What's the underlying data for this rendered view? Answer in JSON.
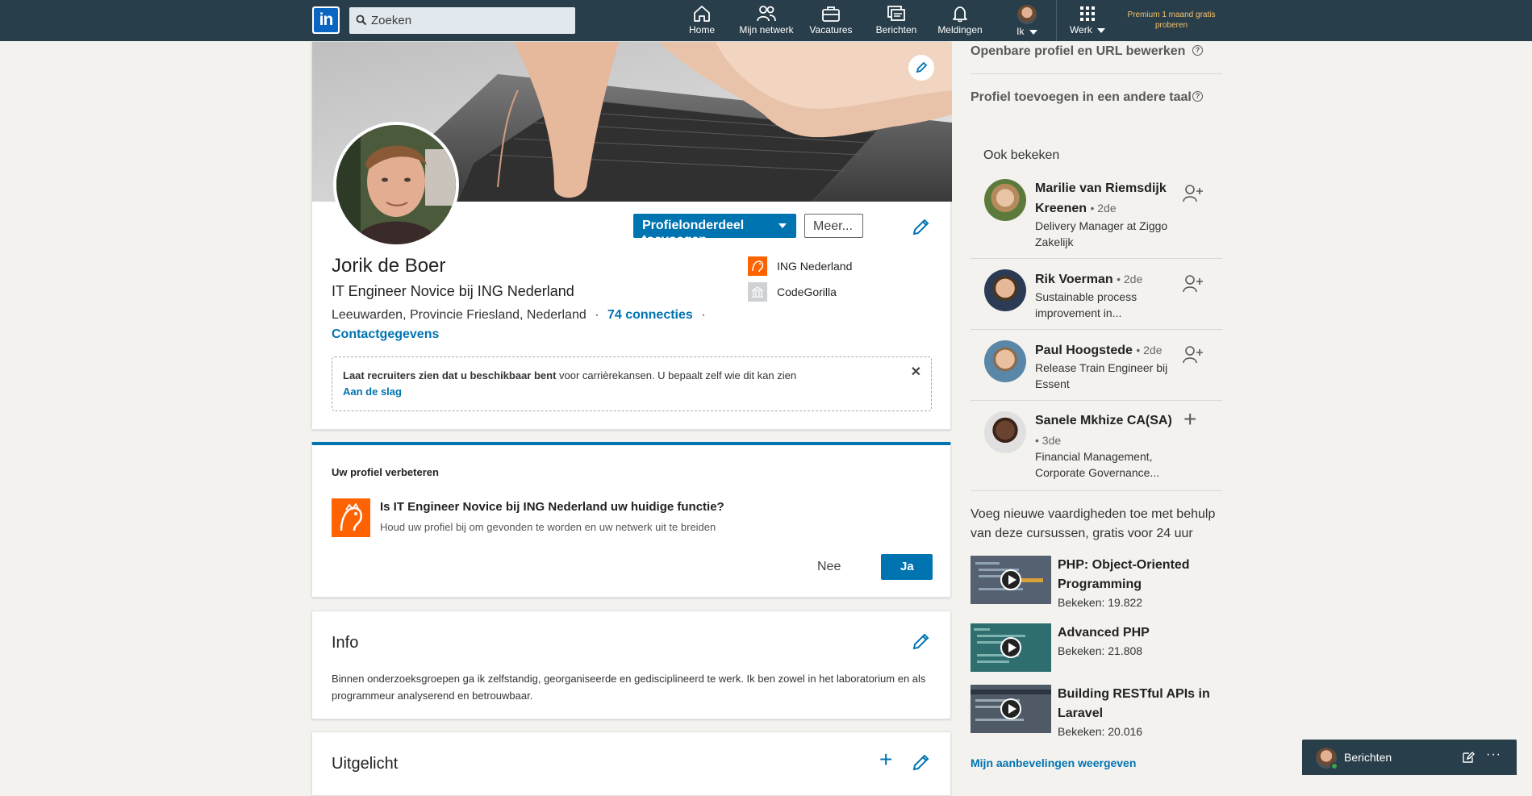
{
  "nav": {
    "search_placeholder": "Zoeken",
    "items": [
      "Home",
      "Mijn netwerk",
      "Vacatures",
      "Berichten",
      "Meldingen",
      "Ik",
      "Werk"
    ],
    "premium": "Premium 1 maand gratis proberen"
  },
  "profile": {
    "add_section": "Profielonderdeel toevoegen",
    "more": "Meer...",
    "name": "Jorik de Boer",
    "headline": "IT Engineer Novice bij ING Nederland",
    "location": "Leeuwarden, Provincie Friesland, Nederland",
    "separator": "·",
    "connections": "74 connecties",
    "contact": "Contactgegevens",
    "companies": [
      "ING Nederland",
      "CodeGorilla"
    ],
    "recruiter_bold": "Laat recruiters zien dat u beschikbaar bent",
    "recruiter_rest": " voor carrièrekansen. U bepaalt zelf wie dit kan zien",
    "recruiter_link": "Aan de slag"
  },
  "improve": {
    "title": "Uw profiel verbeteren",
    "question": "Is IT Engineer Novice bij ING Nederland uw huidige functie?",
    "sub": "Houd uw profiel bij om gevonden te worden en uw netwerk uit te breiden",
    "no": "Nee",
    "yes": "Ja"
  },
  "info": {
    "title": "Info",
    "text": "Binnen onderzoeksgroepen ga ik zelfstandig, georganiseerde en gedisciplineerd te werk. Ik ben zowel in het laboratorium en als programmeur analyserend en betrouwbaar."
  },
  "featured": {
    "title": "Uitgelicht"
  },
  "rail": {
    "edit_public": "Openbare profiel en URL bewerken",
    "add_language": "Profiel toevoegen in een andere taal",
    "also_viewed": "Ook bekeken",
    "people": [
      {
        "name": "Marilie van Riemsdijk Kreenen",
        "degree": "• 2de",
        "desc": "Delivery Manager at Ziggo Zakelijk"
      },
      {
        "name": "Rik Voerman",
        "degree": "• 2de",
        "desc": "Sustainable process improvement in..."
      },
      {
        "name": "Paul Hoogstede",
        "degree": "• 2de",
        "desc": "Release Train Engineer bij Essent"
      },
      {
        "name": "Sanele Mkhize CA(SA)",
        "degree": "• 3de",
        "desc": "Financial Management, Corporate Governance..."
      }
    ],
    "courses_intro": "Voeg nieuwe vaardigheden toe met behulp van deze cursussen, gratis voor 24 uur",
    "courses": [
      {
        "title": "PHP: Object-Oriented Programming",
        "views": "Bekeken: 19.822"
      },
      {
        "title": "Advanced PHP",
        "views": "Bekeken: 21.808"
      },
      {
        "title": "Building RESTful APIs in Laravel",
        "views": "Bekeken: 20.016"
      }
    ],
    "recommendations": "Mijn aanbevelingen weergeven"
  },
  "messaging": {
    "label": "Berichten"
  },
  "colors": {
    "nav": "#283e4a",
    "primary": "#0073b1",
    "ing_orange": "#ff6200",
    "premium": "#f5c16b"
  }
}
